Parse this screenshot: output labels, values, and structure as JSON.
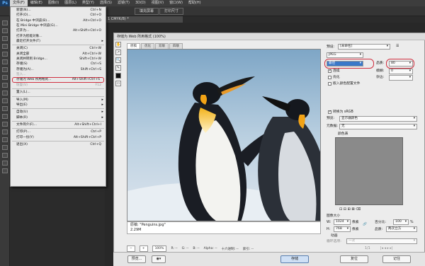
{
  "app": {
    "logo": "Ps"
  },
  "menubar": {
    "items": [
      "文件(F)",
      "编辑(E)",
      "图像(I)",
      "图层(L)",
      "类型(Y)",
      "选择(S)",
      "滤镜(T)",
      "3D(D)",
      "视图(V)",
      "窗口(W)",
      "帮助(H)"
    ]
  },
  "options": {
    "fill_screen": "填充屏幕",
    "print_size": "打印尺寸"
  },
  "document": {
    "tab_title": "1 CMYK/8) *"
  },
  "file_menu": {
    "items": [
      {
        "label": "新建(N)...",
        "shortcut": "Ctrl+N"
      },
      {
        "label": "打开(O)...",
        "shortcut": "Ctrl+O"
      },
      {
        "label": "在 Bridge 中浏览(B)...",
        "shortcut": "Alt+Ctrl+O"
      },
      {
        "label": "在 Mini Bridge 中浏览(G)...",
        "shortcut": ""
      },
      {
        "label": "打开为...",
        "shortcut": "Alt+Shift+Ctrl+O"
      },
      {
        "label": "打开为智能对象...",
        "shortcut": ""
      },
      {
        "label": "最近打开文件(T)",
        "shortcut": ""
      },
      {
        "sep": true
      },
      {
        "label": "关闭(C)",
        "shortcut": "Ctrl+W"
      },
      {
        "label": "关闭全部",
        "shortcut": "Alt+Ctrl+W"
      },
      {
        "label": "关闭并转到 Bridge...",
        "shortcut": "Shift+Ctrl+W"
      },
      {
        "label": "存储(S)",
        "shortcut": "Ctrl+S"
      },
      {
        "label": "存储为(A)...",
        "shortcut": "Shift+Ctrl+S"
      },
      {
        "label": "签入...",
        "shortcut": ""
      },
      {
        "label": "存储为 Web 所用格式...",
        "shortcut": "Alt+Shift+Ctrl+S"
      },
      {
        "label": "恢复(V)",
        "shortcut": "F12"
      },
      {
        "sep": true
      },
      {
        "label": "置入(L)...",
        "shortcut": ""
      },
      {
        "sep": true
      },
      {
        "label": "导入(M)",
        "shortcut": ""
      },
      {
        "label": "导出(E)",
        "shortcut": ""
      },
      {
        "sep": true
      },
      {
        "label": "自动(U)",
        "shortcut": ""
      },
      {
        "label": "脚本(R)",
        "shortcut": ""
      },
      {
        "sep": true
      },
      {
        "label": "文件简介(F)...",
        "shortcut": "Alt+Shift+Ctrl+I"
      },
      {
        "sep": true
      },
      {
        "label": "打印(P)...",
        "shortcut": "Ctrl+P"
      },
      {
        "label": "打印一份(Y)",
        "shortcut": "Alt+Shift+Ctrl+P"
      },
      {
        "sep": true
      },
      {
        "label": "退出(X)",
        "shortcut": "Ctrl+Q"
      }
    ]
  },
  "dialog": {
    "title": "存储为 Web 所用格式 (100%)",
    "tabs": [
      "原稿",
      "优化",
      "双联",
      "四联"
    ],
    "caption_line1": "原稿: \"Penguins.jpg\"",
    "caption_line2": "2.29M",
    "zoom": "100%",
    "status": {
      "r": "R: --",
      "g": "G: --",
      "b": "B: --",
      "alpha": "Alpha: --",
      "hex": "十六进制: --",
      "index": "索引: --"
    },
    "preset_label": "预设:",
    "preset_value": "[未命名]",
    "format_value": "JPEG",
    "quality_level": "最佳",
    "quality_label": "品质:",
    "quality_value": "80",
    "progressive": "连续",
    "blur_label": "模糊:",
    "blur_value": "0",
    "optimized": "优化",
    "matte_label": "杂边:",
    "embed_profile": "嵌入颜色配置文件",
    "convert_srgb": "转换为 sRGB",
    "preview_label": "预览:",
    "preview_value": "显示器颜色",
    "metadata_label": "元数据:",
    "metadata_value": "无",
    "color_table": "颜色表",
    "image_size": "图像大小",
    "w_label": "W:",
    "w_value": "1024",
    "h_label": "H:",
    "h_value": "768",
    "px": "像素",
    "percent_label": "百分比:",
    "percent_value": "100",
    "percent_unit": "%",
    "quality2_label": "品质:",
    "quality2_value": "两次立方",
    "animation": "动画",
    "loop_label": "循环选项:",
    "loop_value": "一次",
    "frame_counter": "1/1",
    "preview_btn": "预览...",
    "save_btn": "存储",
    "reset_btn": "复位",
    "remember_btn": "记住"
  }
}
